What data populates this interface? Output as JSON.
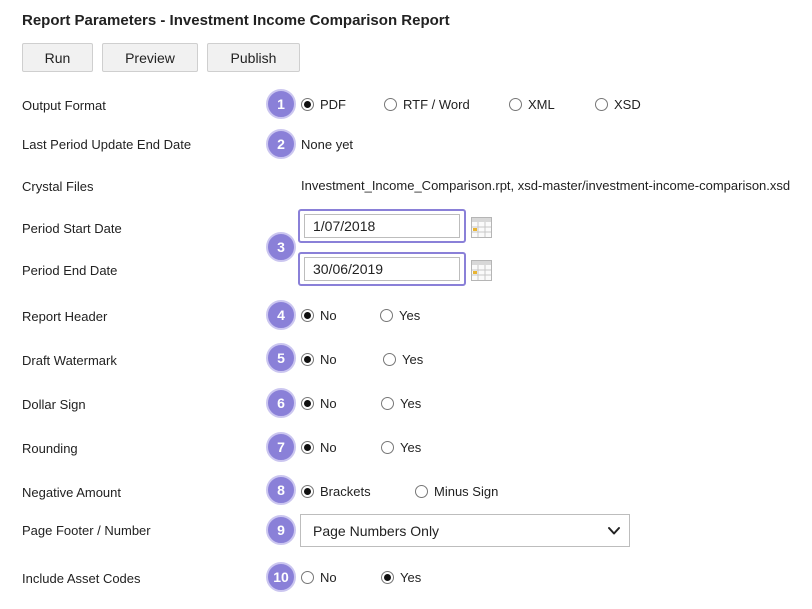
{
  "page": {
    "title": "Report Parameters - Investment Income Comparison Report"
  },
  "toolbar": {
    "run_label": "Run",
    "preview_label": "Preview",
    "publish_label": "Publish"
  },
  "output_format": {
    "label": "Output Format",
    "badge": "1",
    "options": [
      "PDF",
      "RTF / Word",
      "XML",
      "XSD"
    ],
    "selected": "PDF"
  },
  "last_period": {
    "label": "Last Period Update End Date",
    "badge": "2",
    "value": "None yet"
  },
  "crystal_files": {
    "label": "Crystal Files",
    "value": "Investment_Income_Comparison.rpt, xsd-master/investment-income-comparison.xsd"
  },
  "period": {
    "badge": "3",
    "start_label": "Period Start Date",
    "start_value": "1/07/2018",
    "end_label": "Period End Date",
    "end_value": "30/06/2019"
  },
  "report_header": {
    "label": "Report Header",
    "badge": "4",
    "options": [
      "No",
      "Yes"
    ],
    "selected": "No"
  },
  "draft_watermark": {
    "label": "Draft Watermark",
    "badge": "5",
    "options": [
      "No",
      "Yes"
    ],
    "selected": "No"
  },
  "dollar_sign": {
    "label": "Dollar Sign",
    "badge": "6",
    "options": [
      "No",
      "Yes"
    ],
    "selected": "No"
  },
  "rounding": {
    "label": "Rounding",
    "badge": "7",
    "options": [
      "No",
      "Yes"
    ],
    "selected": "No"
  },
  "negative_amount": {
    "label": "Negative Amount",
    "badge": "8",
    "options": [
      "Brackets",
      "Minus Sign"
    ],
    "selected": "Brackets"
  },
  "page_footer": {
    "label": "Page Footer / Number",
    "badge": "9",
    "selected": "Page Numbers Only"
  },
  "asset_codes": {
    "label": "Include Asset Codes",
    "badge": "10",
    "options": [
      "No",
      "Yes"
    ],
    "selected": "Yes"
  },
  "colors": {
    "badge": "#8a80d8",
    "badge_ring": "#cbc6f0",
    "highlight_border": "#8a80d8"
  },
  "icons": {
    "calendar": "calendar-icon",
    "dropdown": "chevron-down-icon"
  }
}
